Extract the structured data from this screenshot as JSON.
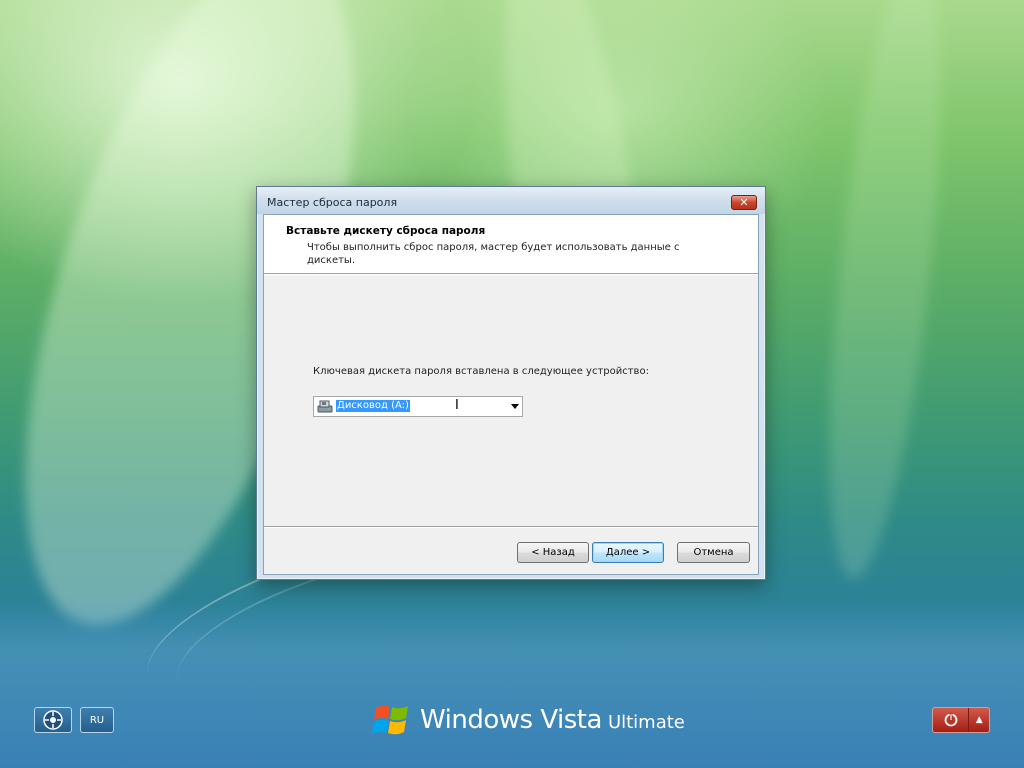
{
  "window": {
    "title": "Мастер сброса пароля",
    "close_glyph": "✕"
  },
  "header": {
    "title": "Вставьте дискету сброса пароля",
    "description": "Чтобы выполнить сброс пароля, мастер будет использовать данные с дискеты."
  },
  "body": {
    "prompt_label": "Ключевая дискета пароля вставлена в следующее устройство:",
    "device_select": {
      "selected_value": "Дисковод (A:)",
      "icon": "floppy-drive-icon"
    }
  },
  "buttons": {
    "back_label": "< Назад",
    "next_label": "Далее >",
    "cancel_label": "Отмена"
  },
  "taskbar": {
    "ease_of_access_icon": "ease-of-access-icon",
    "language_label": "RU",
    "power_icon": "power-icon",
    "power_menu_glyph": "▲"
  },
  "brand": {
    "name": "Windows Vista",
    "edition": "Ultimate"
  },
  "colors": {
    "accent_blue": "#3399ff",
    "power_red": "#a51d12"
  }
}
